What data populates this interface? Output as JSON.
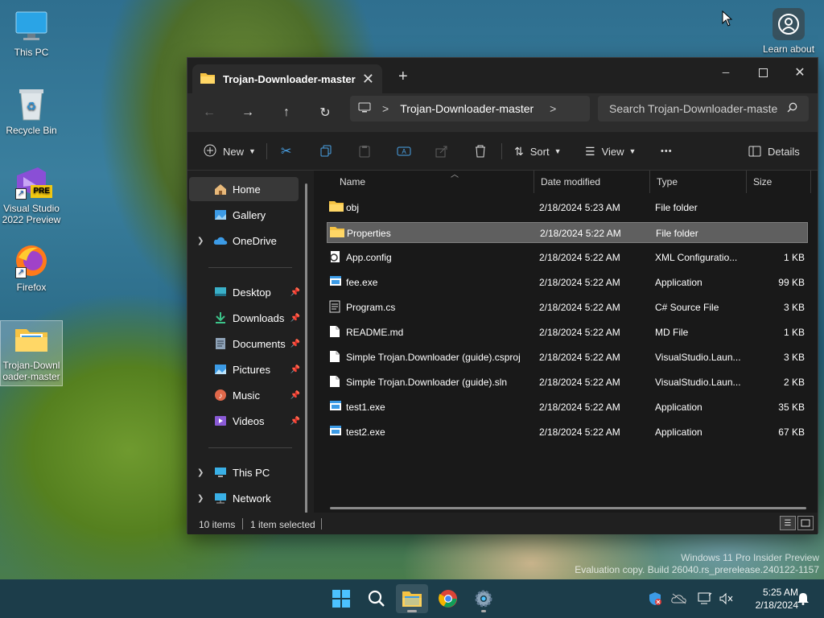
{
  "desktop": {
    "icons": [
      {
        "label": "This PC"
      },
      {
        "label": "Recycle Bin"
      },
      {
        "label": "Visual Studio 2022 Preview",
        "badge": "PRE"
      },
      {
        "label": "Firefox"
      },
      {
        "label": "Trojan-Downloader-master"
      }
    ],
    "learn_about": "Learn about",
    "watermark_line1": "Windows 11 Pro Insider Preview",
    "watermark_line2": "Evaluation copy. Build 26040.rs_prerelease.240122-1157"
  },
  "window": {
    "tab_title": "Trojan-Downloader-master",
    "new_tab": "+",
    "address": {
      "separator": ">",
      "path": "Trojan-Downloader-master"
    },
    "search": {
      "placeholder": "Search Trojan-Downloader-maste"
    },
    "toolbar": {
      "new_label": "New",
      "sort_label": "Sort",
      "view_label": "View",
      "more": "•••",
      "details_label": "Details"
    },
    "nav": {
      "home": "Home",
      "gallery": "Gallery",
      "onedrive": "OneDrive",
      "desktop": "Desktop",
      "downloads": "Downloads",
      "documents": "Documents",
      "pictures": "Pictures",
      "music": "Music",
      "videos": "Videos",
      "this_pc": "This PC",
      "network": "Network"
    },
    "columns": {
      "name": "Name",
      "date": "Date modified",
      "type": "Type",
      "size": "Size"
    },
    "files": [
      {
        "name": "obj",
        "date": "2/18/2024 5:23 AM",
        "type": "File folder",
        "size": "",
        "icon": "folder-icon"
      },
      {
        "name": "Properties",
        "date": "2/18/2024 5:22 AM",
        "type": "File folder",
        "size": "",
        "icon": "folder-icon",
        "selected": true
      },
      {
        "name": "App.config",
        "date": "2/18/2024 5:22 AM",
        "type": "XML Configuratio...",
        "size": "1 KB",
        "icon": "config-file-icon"
      },
      {
        "name": "fee.exe",
        "date": "2/18/2024 5:22 AM",
        "type": "Application",
        "size": "99 KB",
        "icon": "exe-icon"
      },
      {
        "name": "Program.cs",
        "date": "2/18/2024 5:22 AM",
        "type": "C# Source File",
        "size": "3 KB",
        "icon": "text-file-icon"
      },
      {
        "name": "README.md",
        "date": "2/18/2024 5:22 AM",
        "type": "MD File",
        "size": "1 KB",
        "icon": "file-icon"
      },
      {
        "name": "Simple Trojan.Downloader (guide).csproj",
        "date": "2/18/2024 5:22 AM",
        "type": "VisualStudio.Laun...",
        "size": "3 KB",
        "icon": "file-icon"
      },
      {
        "name": "Simple Trojan.Downloader (guide).sln",
        "date": "2/18/2024 5:22 AM",
        "type": "VisualStudio.Laun...",
        "size": "2 KB",
        "icon": "file-icon"
      },
      {
        "name": "test1.exe",
        "date": "2/18/2024 5:22 AM",
        "type": "Application",
        "size": "35 KB",
        "icon": "exe-icon"
      },
      {
        "name": "test2.exe",
        "date": "2/18/2024 5:22 AM",
        "type": "Application",
        "size": "67 KB",
        "icon": "exe-icon"
      }
    ],
    "status": {
      "count": "10 items",
      "selection": "1 item selected"
    }
  },
  "taskbar": {
    "time": "5:25 AM",
    "date": "2/18/2024"
  },
  "colors": {
    "window_bg": "#202020",
    "content_bg": "#191919",
    "folder_yellow": "#f6c343",
    "accent_blue": "#3c9be6",
    "taskbar": "#1c3d4a"
  }
}
